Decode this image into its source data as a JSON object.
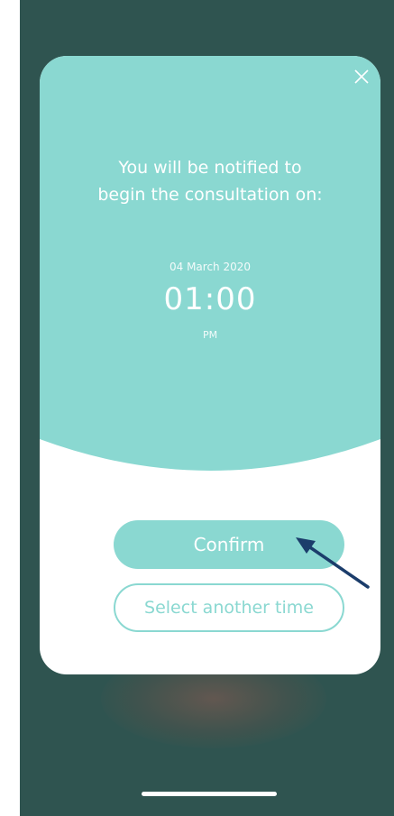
{
  "modal": {
    "message_line1": "You will be notified to",
    "message_line2": "begin the consultation on:",
    "date": "04 March 2020",
    "time": "01:00",
    "meridiem": "PM",
    "confirm_label": "Confirm",
    "other_time_label": "Select another time",
    "close_icon": "close-icon"
  },
  "colors": {
    "backdrop": "#2f5450",
    "accent": "#8ad8d1",
    "card": "#ffffff",
    "annotation_arrow": "#1b3d6b"
  }
}
